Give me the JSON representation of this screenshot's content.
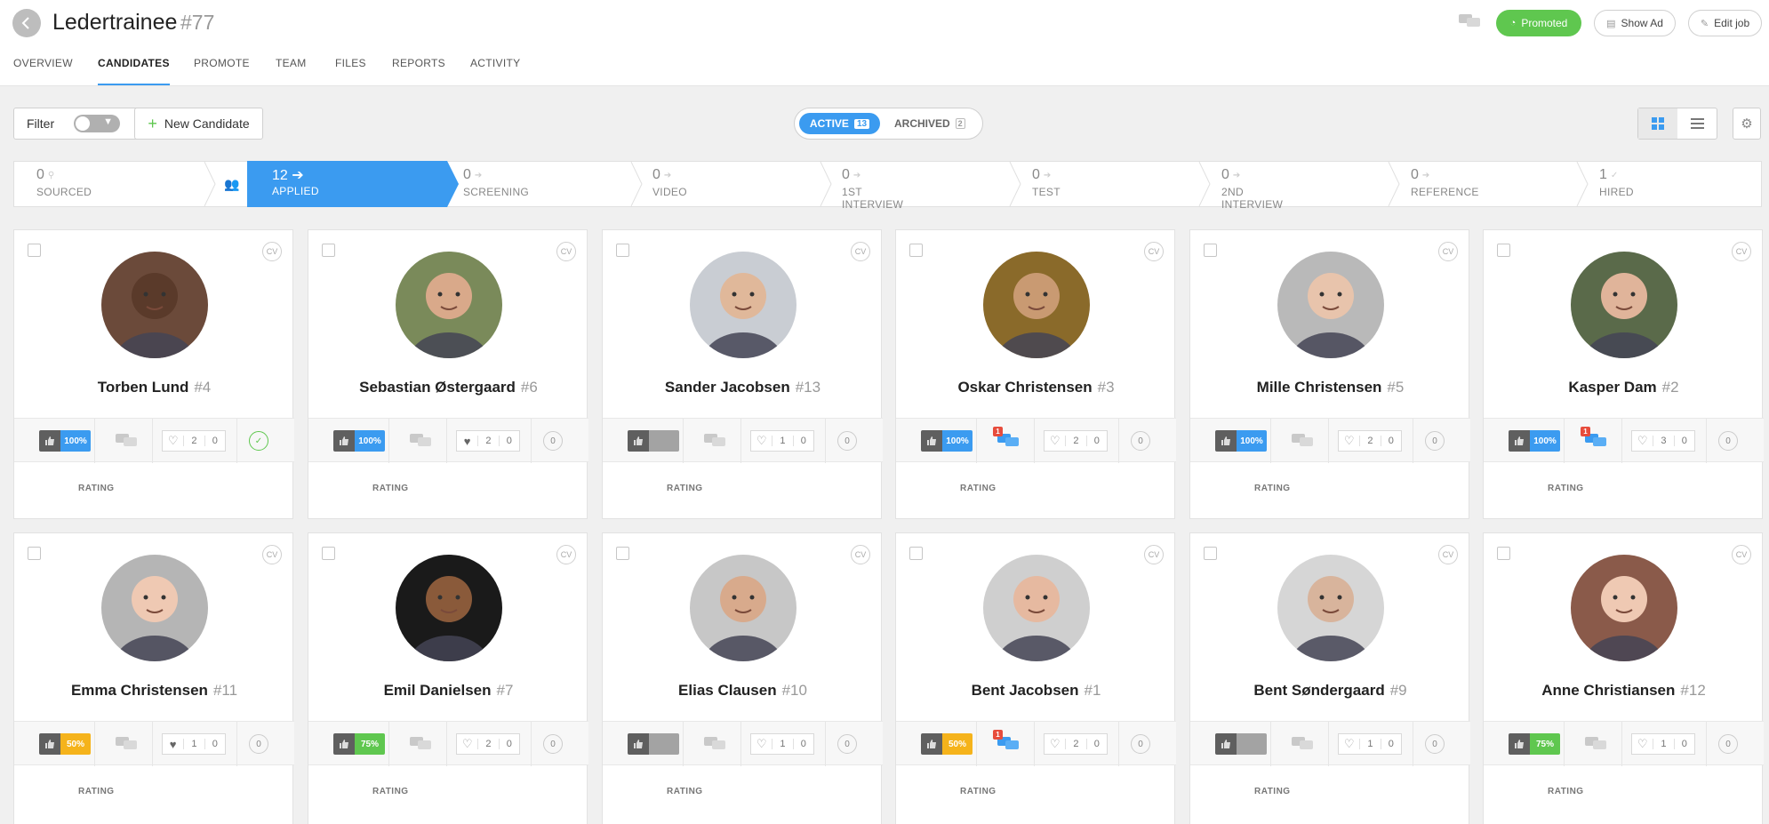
{
  "header": {
    "title": "Ledertrainee",
    "job_number": "#77",
    "promoted_label": "Promoted",
    "show_ad_label": "Show Ad",
    "edit_job_label": "Edit job"
  },
  "tabs": [
    "OVERVIEW",
    "CANDIDATES",
    "PROMOTE",
    "TEAM",
    "FILES",
    "REPORTS",
    "ACTIVITY"
  ],
  "active_tab": "CANDIDATES",
  "toolbar": {
    "filter_label": "Filter",
    "new_candidate_label": "New Candidate",
    "active_label": "ACTIVE",
    "active_count": "13",
    "archived_label": "ARCHIVED",
    "archived_count": "2"
  },
  "pipeline": [
    {
      "count": "0",
      "label": "SOURCED"
    },
    {
      "count": "12",
      "label": "APPLIED"
    },
    {
      "count": "0",
      "label": "SCREENING"
    },
    {
      "count": "0",
      "label": "VIDEO"
    },
    {
      "count": "0",
      "label": "1ST INTERVIEW"
    },
    {
      "count": "0",
      "label": "TEST"
    },
    {
      "count": "0",
      "label": "2ND INTERVIEW"
    },
    {
      "count": "0",
      "label": "REFERENCE"
    },
    {
      "count": "1",
      "label": "HIRED"
    }
  ],
  "colors": {
    "accent": "#3b9bf0",
    "green": "#5fc74f",
    "vote_blue": "#3b9bf0",
    "vote_yellow": "#f5b31b",
    "vote_green": "#5fc74f",
    "vote_none": "#a3a3a3",
    "badge_red": "#e74c3c"
  },
  "rating_label": "RATING",
  "cv_label": "CV",
  "candidates": [
    {
      "name": "Torben Lund",
      "number": "#4",
      "vote": "100%",
      "vote_color": "blue",
      "messages": "",
      "likes": "2",
      "comments": "0",
      "status": "✓",
      "status_done": true,
      "avatar_bg": "#6b4a3a",
      "skin": "#5a3a2a"
    },
    {
      "name": "Sebastian Østergaard",
      "number": "#6",
      "vote": "100%",
      "vote_color": "blue",
      "messages": "",
      "likes": "2",
      "comments": "0",
      "status": "0",
      "liked": true,
      "avatar_bg": "#7a8a5a",
      "skin": "#d9a98a"
    },
    {
      "name": "Sander Jacobsen",
      "number": "#13",
      "vote": "",
      "vote_color": "none",
      "messages": "",
      "likes": "1",
      "comments": "0",
      "status": "0",
      "avatar_bg": "#c9cdd3",
      "skin": "#e0b89a"
    },
    {
      "name": "Oskar Christensen",
      "number": "#3",
      "vote": "100%",
      "vote_color": "blue",
      "messages": "1",
      "likes": "2",
      "comments": "0",
      "status": "0",
      "avatar_bg": "#8a6a2a",
      "skin": "#c99a72"
    },
    {
      "name": "Mille Christensen",
      "number": "#5",
      "vote": "100%",
      "vote_color": "blue",
      "messages": "",
      "likes": "2",
      "comments": "0",
      "status": "0",
      "avatar_bg": "#b9b9b9",
      "skin": "#e8c4ac"
    },
    {
      "name": "Kasper Dam",
      "number": "#2",
      "vote": "100%",
      "vote_color": "blue",
      "messages": "1",
      "likes": "3",
      "comments": "0",
      "status": "0",
      "avatar_bg": "#5a6a4a",
      "skin": "#e0b49a"
    },
    {
      "name": "Emma Christensen",
      "number": "#11",
      "vote": "50%",
      "vote_color": "yellow",
      "messages": "",
      "likes": "1",
      "comments": "0",
      "status": "0",
      "liked": true,
      "avatar_bg": "#b5b5b5",
      "skin": "#efc9b3"
    },
    {
      "name": "Emil Danielsen",
      "number": "#7",
      "vote": "75%",
      "vote_color": "green",
      "messages": "",
      "likes": "2",
      "comments": "0",
      "status": "0",
      "avatar_bg": "#1a1a1a",
      "skin": "#8a5a3a"
    },
    {
      "name": "Elias Clausen",
      "number": "#10",
      "vote": "",
      "vote_color": "none",
      "messages": "",
      "likes": "1",
      "comments": "0",
      "status": "0",
      "avatar_bg": "#c7c7c7",
      "skin": "#d8aa8c"
    },
    {
      "name": "Bent Jacobsen",
      "number": "#1",
      "vote": "50%",
      "vote_color": "yellow",
      "messages": "1",
      "likes": "2",
      "comments": "0",
      "status": "0",
      "avatar_bg": "#cfcfcf",
      "skin": "#e6b9a0"
    },
    {
      "name": "Bent Søndergaard",
      "number": "#9",
      "vote": "",
      "vote_color": "none",
      "messages": "",
      "likes": "1",
      "comments": "0",
      "status": "0",
      "avatar_bg": "#d6d6d6",
      "skin": "#d8b49c"
    },
    {
      "name": "Anne Christiansen",
      "number": "#12",
      "vote": "75%",
      "vote_color": "green",
      "messages": "",
      "likes": "1",
      "comments": "0",
      "status": "0",
      "avatar_bg": "#8a5a4a",
      "skin": "#efc9b3"
    }
  ]
}
